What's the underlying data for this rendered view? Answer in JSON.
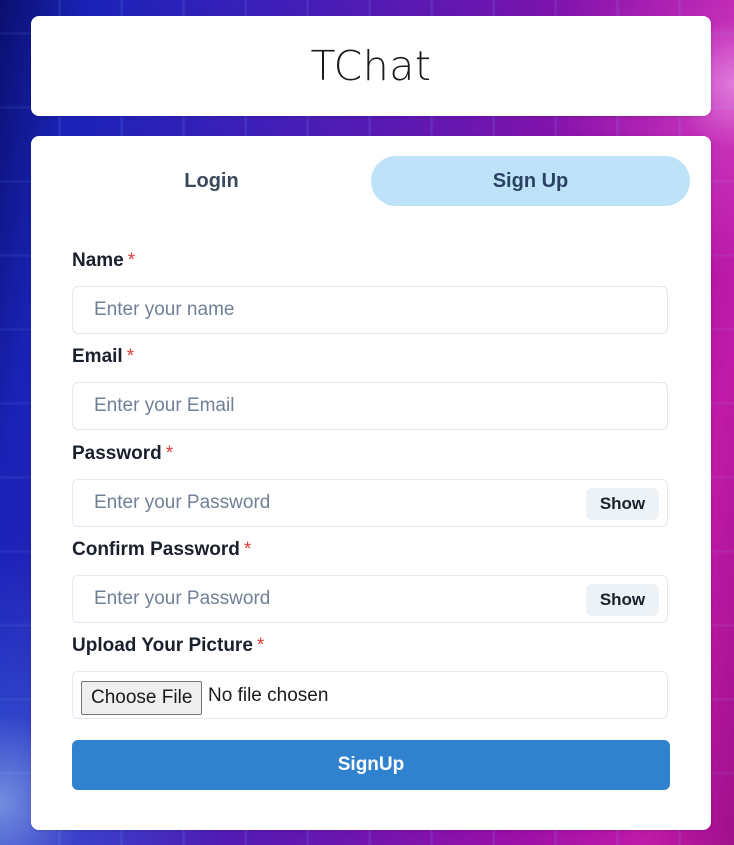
{
  "app": {
    "title": "TChat"
  },
  "tabs": [
    {
      "label": "Login",
      "active": false
    },
    {
      "label": "Sign Up",
      "active": true
    }
  ],
  "form": {
    "required_marker": "*",
    "name": {
      "label": "Name",
      "placeholder": "Enter your name",
      "value": ""
    },
    "email": {
      "label": "Email",
      "placeholder": "Enter your Email",
      "value": ""
    },
    "password": {
      "label": "Password",
      "placeholder": "Enter your Password",
      "value": "",
      "toggle_label": "Show"
    },
    "confirm_password": {
      "label": "Confirm Password",
      "placeholder": "Enter your Password",
      "value": "",
      "toggle_label": "Show"
    },
    "picture": {
      "label": "Upload Your Picture",
      "button_label": "Choose File",
      "status": "No file chosen"
    },
    "submit_label": "SignUp"
  },
  "colors": {
    "tab_active_bg": "#bee3f8",
    "submit_bg": "#3182ce",
    "required": "#e53e3e"
  }
}
